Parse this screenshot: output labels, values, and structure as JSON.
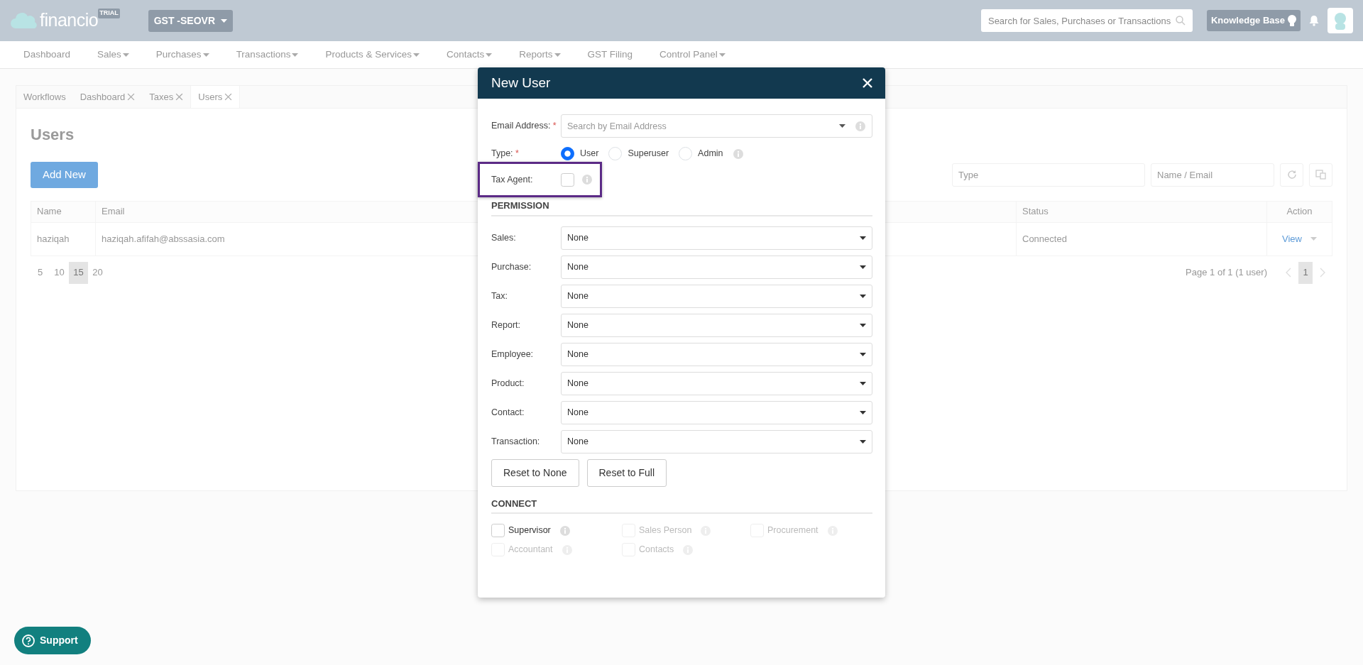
{
  "topbar": {
    "brand": "financio",
    "badge": "TRIAL",
    "company": "GST -SEOVR",
    "search": {
      "placeholder": "Search for Sales, Purchases or Transactions"
    },
    "help": "Knowledge Base"
  },
  "nav": [
    {
      "label": "Dashboard",
      "dropdown": false
    },
    {
      "label": "Sales",
      "dropdown": true
    },
    {
      "label": "Purchases",
      "dropdown": true
    },
    {
      "label": "Transactions",
      "dropdown": true
    },
    {
      "label": "Products & Services",
      "dropdown": true
    },
    {
      "label": "Contacts",
      "dropdown": true
    },
    {
      "label": "Reports",
      "dropdown": true
    },
    {
      "label": "GST Filing",
      "dropdown": false
    },
    {
      "label": "Control Panel",
      "dropdown": true
    }
  ],
  "tabs": [
    {
      "label": "Workflows",
      "closable": false,
      "selected": false
    },
    {
      "label": "Dashboard",
      "closable": true,
      "selected": false
    },
    {
      "label": "Taxes",
      "closable": true,
      "selected": false
    },
    {
      "label": "Users",
      "closable": true,
      "selected": true
    }
  ],
  "page": {
    "title": "Users",
    "add_button": "Add New",
    "filters": [
      {
        "placeholder": "Type"
      },
      {
        "placeholder": "Name / Email"
      }
    ],
    "table": {
      "columns": [
        "Name",
        "Email",
        "Status",
        "Action"
      ],
      "rows": [
        {
          "name": "haziqah",
          "email": "haziqah.afifah@abssasia.com",
          "status": "Connected",
          "action": "View"
        }
      ]
    },
    "page_sizes": [
      {
        "label": "5",
        "selected": false
      },
      {
        "label": "10",
        "selected": false
      },
      {
        "label": "15",
        "selected": true
      },
      {
        "label": "20",
        "selected": false
      }
    ],
    "pagination": {
      "summary": "Page 1 of 1 (1 user)",
      "pages": [
        {
          "label": "1",
          "selected": true
        }
      ]
    }
  },
  "modal": {
    "title": "New User",
    "email": {
      "label": "Email Address:",
      "required": "*",
      "placeholder": "Search by Email Address"
    },
    "type": {
      "label": "Type:",
      "required": "*",
      "options": [
        {
          "label": "User",
          "selected": true
        },
        {
          "label": "Superuser",
          "selected": false
        },
        {
          "label": "Admin",
          "selected": false
        }
      ]
    },
    "tax_agent": {
      "label": "Tax Agent:",
      "checked": false,
      "highlighted": true
    },
    "permission_heading": "PERMISSION",
    "permissions": [
      {
        "label": "Sales:",
        "value": "None"
      },
      {
        "label": "Purchase:",
        "value": "None"
      },
      {
        "label": "Tax:",
        "value": "None"
      },
      {
        "label": "Report:",
        "value": "None"
      },
      {
        "label": "Employee:",
        "value": "None"
      },
      {
        "label": "Product:",
        "value": "None"
      },
      {
        "label": "Contact:",
        "value": "None"
      },
      {
        "label": "Transaction:",
        "value": "None"
      }
    ],
    "buttons": [
      "Reset to None",
      "Reset to Full"
    ],
    "connect_heading": "CONNECT",
    "connect": [
      {
        "label": "Supervisor",
        "checked": false,
        "disabled": false
      },
      {
        "label": "Sales Person",
        "checked": false,
        "disabled": true
      },
      {
        "label": "Procurement",
        "checked": false,
        "disabled": true
      },
      {
        "label": "Accountant",
        "checked": false,
        "disabled": true
      },
      {
        "label": "Contacts",
        "checked": false,
        "disabled": true
      }
    ]
  },
  "support": "Support"
}
